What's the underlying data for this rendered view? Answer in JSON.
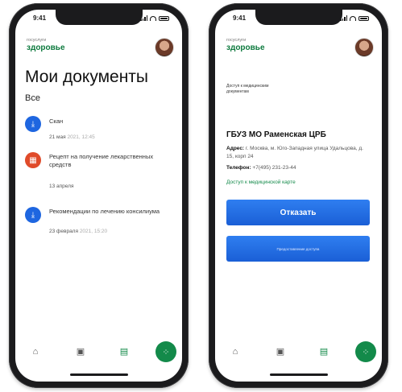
{
  "phone1": {
    "status": {
      "time": "9:41"
    },
    "brand": {
      "sub": "госуслуги",
      "main": "здоровье"
    },
    "page_title": "Мои документы",
    "filter": "Все",
    "documents": [
      {
        "icon": "download-icon",
        "title": "Скан",
        "date": "21 мая",
        "date_extra": "2021, 12:45"
      },
      {
        "icon": "recipe-icon",
        "title": "Рецепт на получение лекарственных средств",
        "date": "13 апреля",
        "date_extra": ""
      },
      {
        "icon": "download-icon",
        "title": "Рекомендации по лечению консилиума",
        "date": "23 февраля",
        "date_extra": "2021, 15:20"
      }
    ],
    "tabs": [
      {
        "icon": "home-icon"
      },
      {
        "icon": "calendar-icon"
      },
      {
        "icon": "document-icon"
      },
      {
        "icon": "services-icon"
      }
    ]
  },
  "phone2": {
    "status": {
      "time": "9:41"
    },
    "brand": {
      "sub": "госуслуги",
      "main": "здоровье"
    },
    "breadcrumb": "Доступ к медицинским документам",
    "org_title": "ГБУЗ МО Раменская ЦРБ",
    "address_label": "Адрес:",
    "address_value": "г. Москва, м. Юго-Западная улица Удальцова, д. 15, корп 24",
    "phone_label": "Телефон:",
    "phone_value": "+7(495) 231-23-44",
    "access_link": "Доступ к медицинской карте",
    "primary_button": "Отказать",
    "secondary_button": "Предоставление доступа",
    "tabs": [
      {
        "icon": "home-icon"
      },
      {
        "icon": "calendar-icon"
      },
      {
        "icon": "document-icon"
      },
      {
        "icon": "services-icon"
      }
    ]
  },
  "colors": {
    "brand_green": "#0d7a3e",
    "accent_blue": "#1e66e0",
    "recipe_red": "#e04b2a",
    "fab_green": "#138a4a"
  }
}
